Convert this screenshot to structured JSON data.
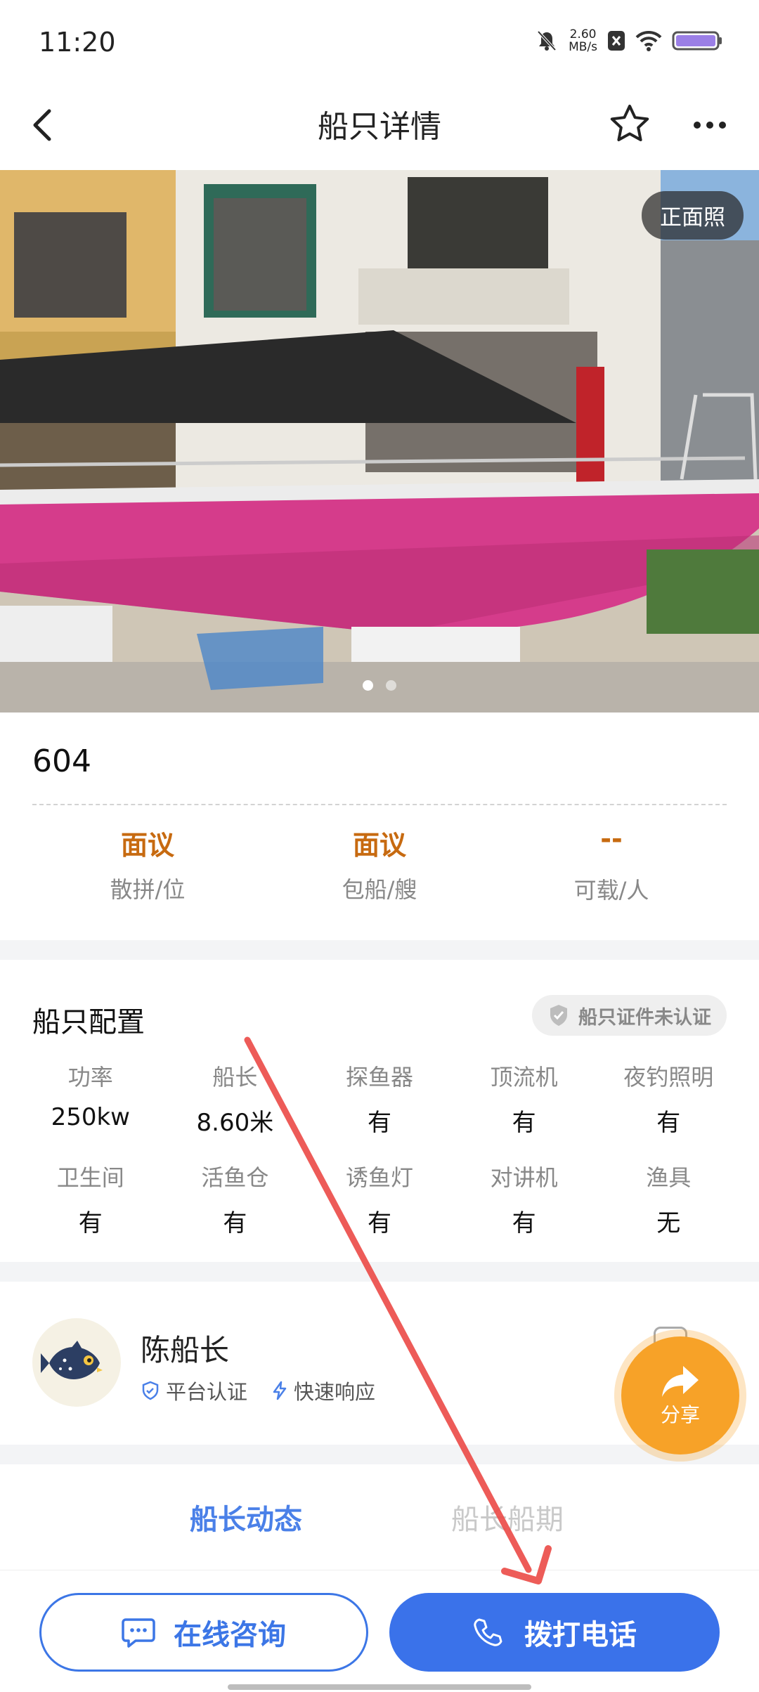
{
  "status_bar": {
    "time": "11:20",
    "speed_value": "2.60",
    "speed_unit": "MB/s"
  },
  "nav": {
    "title": "船只详情"
  },
  "hero": {
    "photo_tag": "正面照",
    "photo_index": 1,
    "photo_count": 2
  },
  "boat": {
    "name": "604",
    "prices": [
      {
        "value": "面议",
        "label": "散拼/位"
      },
      {
        "value": "面议",
        "label": "包船/艘"
      },
      {
        "value": "--",
        "label": "可载/人"
      }
    ]
  },
  "config": {
    "title": "船只配置",
    "cert_label": "船只证件未认证",
    "specs": [
      {
        "label": "功率",
        "value": "250kw"
      },
      {
        "label": "船长",
        "value": "8.60米"
      },
      {
        "label": "探鱼器",
        "value": "有"
      },
      {
        "label": "顶流机",
        "value": "有"
      },
      {
        "label": "夜钓照明",
        "value": "有"
      },
      {
        "label": "卫生间",
        "value": "有"
      },
      {
        "label": "活鱼仓",
        "value": "有"
      },
      {
        "label": "诱鱼灯",
        "value": "有"
      },
      {
        "label": "对讲机",
        "value": "有"
      },
      {
        "label": "渔具",
        "value": "无"
      }
    ]
  },
  "captain": {
    "name": "陈船长",
    "tag_verified": "平台认证",
    "tag_fast": "快速响应"
  },
  "share": {
    "label": "分享"
  },
  "tabs": [
    {
      "label": "船长动态"
    },
    {
      "label": "船长船期"
    }
  ],
  "bottom": {
    "consult_label": "在线咨询",
    "call_label": "拨打电话"
  },
  "colors": {
    "accent_blue": "#3a72ea",
    "price_orange": "#c76a10",
    "share_orange": "#f7a228",
    "annotation_red": "#ec4e4a"
  }
}
